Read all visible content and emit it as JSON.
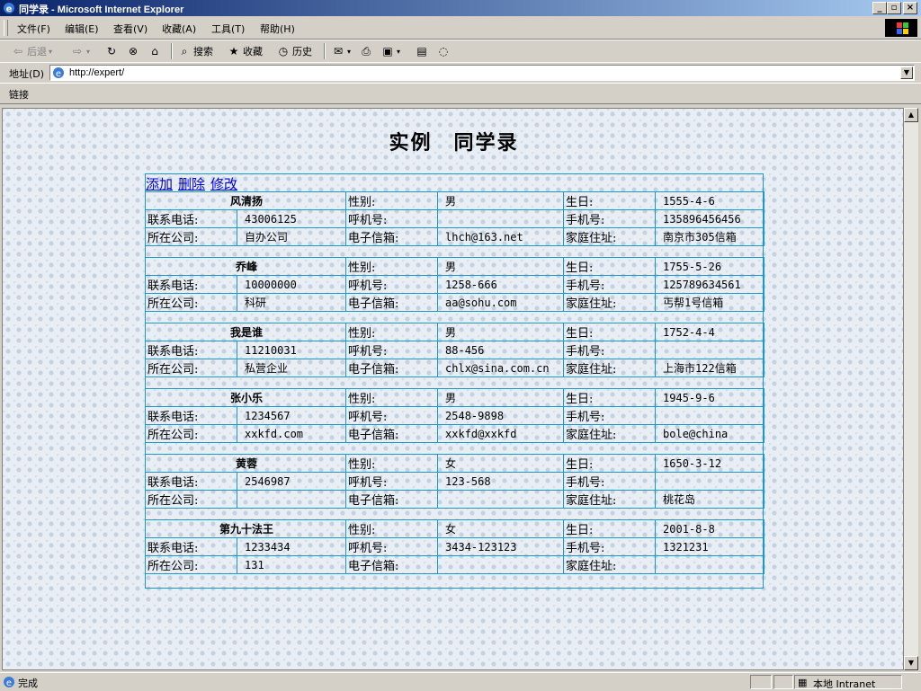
{
  "window": {
    "title": "同学录 - Microsoft Internet Explorer",
    "min": "_",
    "restore": "▫",
    "close": "×"
  },
  "menu": [
    "文件(F)",
    "编辑(E)",
    "查看(V)",
    "收藏(A)",
    "工具(T)",
    "帮助(H)"
  ],
  "toolbar": {
    "back": "后退",
    "search": "搜索",
    "favorites": "收藏",
    "history": "历史"
  },
  "address": {
    "label": "地址(D)",
    "url": "http://expert/"
  },
  "links": {
    "label": "链接"
  },
  "page": {
    "title": "实例　同学录",
    "actions": [
      "添加",
      "删除",
      "修改"
    ],
    "labels": {
      "gender": "性别:",
      "birthday": "生日:",
      "phone": "联系电话:",
      "pager": "呼机号:",
      "mobile": "手机号:",
      "company": "所在公司:",
      "email": "电子信箱:",
      "home": "家庭住址:"
    },
    "records": [
      {
        "name": "风清扬",
        "gender": "男",
        "birthday": "1555-4-6",
        "phone": "43006125",
        "pager": "",
        "mobile": "135896456456",
        "company": "自办公司",
        "email": "lhch@163.net",
        "home": "南京市305信箱"
      },
      {
        "name": "乔峰",
        "gender": "男",
        "birthday": "1755-5-26",
        "phone": "10000000",
        "pager": "1258-666",
        "mobile": "125789634561",
        "company": "科研",
        "email": "aa@sohu.com",
        "home": "丐帮1号信箱"
      },
      {
        "name": "我是谁",
        "gender": "男",
        "birthday": "1752-4-4",
        "phone": "11210031",
        "pager": "88-456",
        "mobile": "",
        "company": "私营企业",
        "email": "chlx@sina.com.cn",
        "home": "上海市122信箱"
      },
      {
        "name": "张小乐",
        "gender": "男",
        "birthday": "1945-9-6",
        "phone": "1234567",
        "pager": "2548-9898",
        "mobile": "",
        "company": "xxkfd.com",
        "email": "xxkfd@xxkfd",
        "home": "bole@china"
      },
      {
        "name": "黄蓉",
        "gender": "女",
        "birthday": "1650-3-12",
        "phone": "2546987",
        "pager": "123-568",
        "mobile": "",
        "company": "",
        "email": "",
        "home": "桃花岛"
      },
      {
        "name": "第九十法王",
        "gender": "女",
        "birthday": "2001-8-8",
        "phone": "1233434",
        "pager": "3434-123123",
        "mobile": "1321231",
        "company": "131",
        "email": "",
        "home": ""
      }
    ]
  },
  "status": {
    "left": "完成",
    "zone": "本地 Intranet"
  }
}
